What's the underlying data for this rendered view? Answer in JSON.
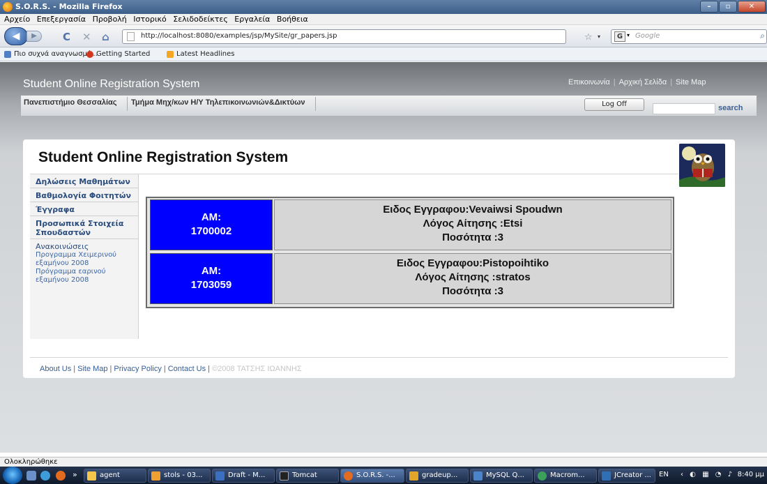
{
  "window": {
    "title": "S.O.R.S. - Mozilla Firefox",
    "controls": [
      "–",
      "▫",
      "✕"
    ]
  },
  "menu": [
    "Αρχείο",
    "Επεξεργασία",
    "Προβολή",
    "Ιστορικό",
    "Σελιδοδείκτες",
    "Εργαλεία",
    "Βοήθεια"
  ],
  "toolbar": {
    "url": "http://localhost:8080/examples/jsp/MySite/gr_papers.jsp",
    "search_placeholder": "Google",
    "search_engine_letter": "G"
  },
  "bookmarks": [
    "Πιο συχνά αναγνωσμέ...",
    "Getting Started",
    "Latest Headlines"
  ],
  "site": {
    "title": "Student Online Registration System",
    "top_links": [
      "Επικοινωνία",
      "Αρχική Σελίδα",
      "Site Map"
    ],
    "crumbs": [
      "Πανεπιστήμιο Θεσσαλίας",
      "Τμήμα Μηχ/κων Η/Υ Τηλεπικοινωνιών&Δικτύων"
    ],
    "logoff_label": "Log Off",
    "search_label": "search"
  },
  "card": {
    "title": "Student Online Registration System"
  },
  "sidebar": {
    "items": [
      "Δηλώσεις Μαθημάτων",
      "Βαθμολογία Φοιτητών",
      "Έγγραφα",
      "Προσωπικά Στοιχεία Σπουδαστών"
    ],
    "announcements_heading": "Ανακοινώσεις",
    "announcements": [
      "Προγραμμα Χειμερινού εξαμήνου 2008",
      "Πρόγραμμα εαρινού εξαμήνου 2008"
    ]
  },
  "records": [
    {
      "am_label": "AM:",
      "am": "1700002",
      "doc_type": "Ειδος Εγγραφου:Vevaiwsi Spoudwn",
      "reason": "Λόγος Αίτησης :Etsi",
      "quantity": "Ποσότητα :3"
    },
    {
      "am_label": "AM:",
      "am": "1703059",
      "doc_type": "Ειδος Εγγραφου:Pistopoihtiko",
      "reason": "Λόγος Αίτησης :stratos",
      "quantity": "Ποσότητα :3"
    }
  ],
  "footer": {
    "links": [
      "About Us",
      "Site Map",
      "Privacy Policy",
      "Contact Us"
    ],
    "copyright": "©2008 ΤΑΤΣΗΣ ΙΩΑΝΝΗΣ"
  },
  "status": "Ολοκληρώθηκε",
  "taskbar": {
    "tasks": [
      "agent",
      "stols - 03...",
      "Draft - M...",
      "Tomcat",
      "S.O.R.S. -...",
      "gradeup...",
      "MySQL Q...",
      "Macrom...",
      "JCreator ..."
    ],
    "language": "EN",
    "clock": "8:40 μμ"
  }
}
